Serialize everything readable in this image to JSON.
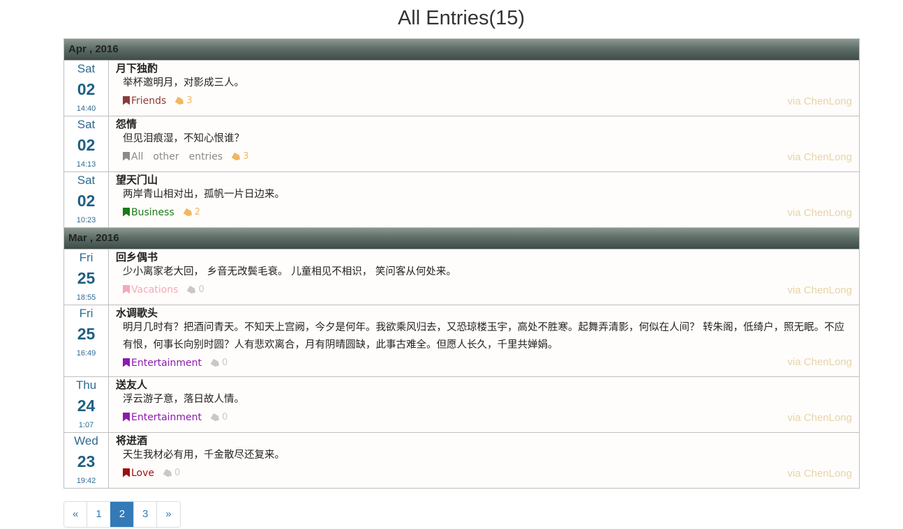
{
  "page": {
    "title": "All Entries(15)"
  },
  "groups": [
    {
      "month": "Apr , 2016",
      "entries": [
        {
          "weekday": "Sat",
          "day": "02",
          "time": "14:40",
          "title": "月下独酌",
          "body": "举杯邀明月，对影成三人。",
          "category": "Friends",
          "category_color": "#8b3a3a",
          "tag_count": "3",
          "tag_color": "#f0b860",
          "via": "via ChenLong"
        },
        {
          "weekday": "Sat",
          "day": "02",
          "time": "14:13",
          "title": "怨情",
          "body": "但见泪痕湿，不知心恨谁？",
          "category": "All　other　entries",
          "category_color": "#8a8a8a",
          "tag_count": "3",
          "tag_color": "#f0b860",
          "via": "via ChenLong"
        },
        {
          "weekday": "Sat",
          "day": "02",
          "time": "10:23",
          "title": "望天门山",
          "body": "两岸青山相对出，孤帆一片日边来。",
          "category": "Business",
          "category_color": "#1a7a1a",
          "tag_count": "2",
          "tag_color": "#f0b860",
          "via": "via ChenLong"
        }
      ]
    },
    {
      "month": "Mar , 2016",
      "entries": [
        {
          "weekday": "Fri",
          "day": "25",
          "time": "18:55",
          "title": "回乡偶书",
          "body": "少小离家老大回， 乡音无改鬓毛衰。 儿童相见不相识， 笑问客从何处来。",
          "category": "Vacations",
          "category_color": "#f4a9b8",
          "tag_count": "0",
          "tag_color": "#c8c8c8",
          "via": "via ChenLong"
        },
        {
          "weekday": "Fri",
          "day": "25",
          "time": "16:49",
          "title": "水调歌头",
          "body": "明月几时有？把酒问青天。不知天上宫阙，今夕是何年。我欲乘风归去，又恐琼楼玉宇，高处不胜寒。起舞弄清影，何似在人间？ 转朱阁，低绮户，照无眠。不应有恨，何事长向别时圆？人有悲欢离合，月有阴晴圆缺，此事古难全。但愿人长久，千里共婵娟。",
          "category": "Entertainment",
          "category_color": "#8a1ab0",
          "tag_count": "0",
          "tag_color": "#c8c8c8",
          "via": "via ChenLong"
        },
        {
          "weekday": "Thu",
          "day": "24",
          "time": "1:07",
          "title": "送友人",
          "body": "浮云游子意，落日故人情。",
          "category": "Entertainment",
          "category_color": "#8a1ab0",
          "tag_count": "0",
          "tag_color": "#c8c8c8",
          "via": "via ChenLong"
        },
        {
          "weekday": "Wed",
          "day": "23",
          "time": "19:42",
          "title": "将进酒",
          "body": "天生我材必有用，千金散尽还复来。",
          "category": "Love",
          "category_color": "#9a1010",
          "tag_count": "0",
          "tag_color": "#c8c8c8",
          "via": "via ChenLong"
        }
      ]
    }
  ],
  "pagination": {
    "prev": "«",
    "pages": [
      "1",
      "2",
      "3"
    ],
    "active": "2",
    "next": "»"
  }
}
